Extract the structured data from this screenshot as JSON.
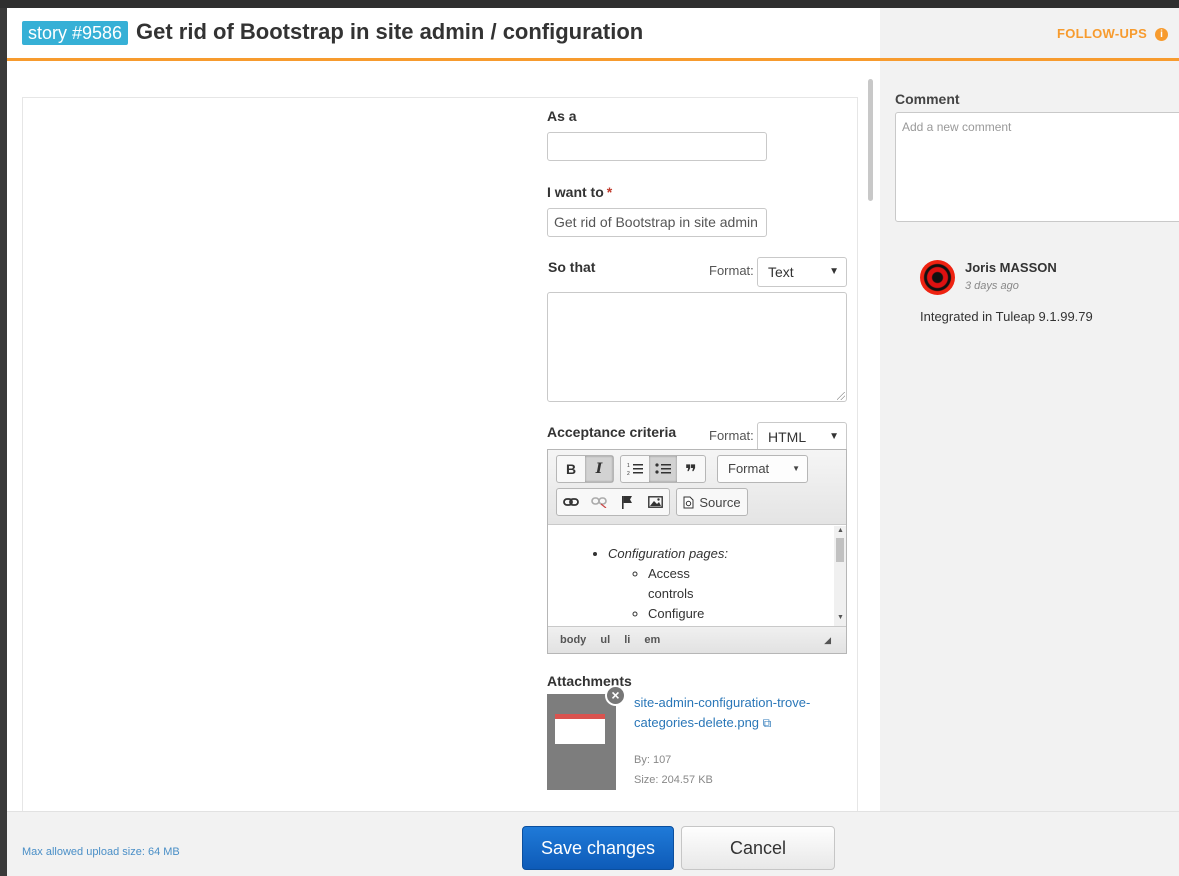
{
  "header": {
    "badge": "story #9586",
    "title": "Get rid of Bootstrap in site admin / configuration",
    "followups_label": "FOLLOW-UPS"
  },
  "form": {
    "as_a": {
      "label": "As a",
      "value": ""
    },
    "i_want_to": {
      "label": "I want to",
      "required_mark": "*",
      "value": "Get rid of Bootstrap in site admin"
    },
    "so_that": {
      "label": "So that",
      "format_label": "Format:",
      "format_value": "Text",
      "value": ""
    },
    "acceptance": {
      "label": "Acceptance criteria",
      "format_label": "Format:",
      "format_value": "HTML",
      "toolbar": {
        "bold": "B",
        "italic": "I",
        "quote": "❞",
        "format_combo": "Format",
        "source": "Source"
      },
      "content": {
        "item": "Configuration pages:",
        "subitems": [
          "Access controls",
          "Configure"
        ]
      },
      "path": [
        "body",
        "ul",
        "li",
        "em"
      ]
    },
    "attachments": {
      "label": "Attachments",
      "file_name": "site-admin-configuration-trove-categories-delete.png",
      "by": "By: 107",
      "size": "Size: 204.57 KB"
    }
  },
  "comments": {
    "label": "Comment",
    "placeholder": "Add a new comment",
    "items": [
      {
        "author": "Joris MASSON",
        "time": "3 days ago",
        "text": "Integrated in Tuleap 9.1.99.79"
      }
    ]
  },
  "footer": {
    "upload_note": "Max allowed upload size: 64 MB",
    "save_label": "Save changes",
    "cancel_label": "Cancel"
  },
  "colors": {
    "accent": "#f79b2e",
    "badge": "#36b0d6",
    "primary_button": "#0e5bb8",
    "link": "#2a77b8"
  }
}
